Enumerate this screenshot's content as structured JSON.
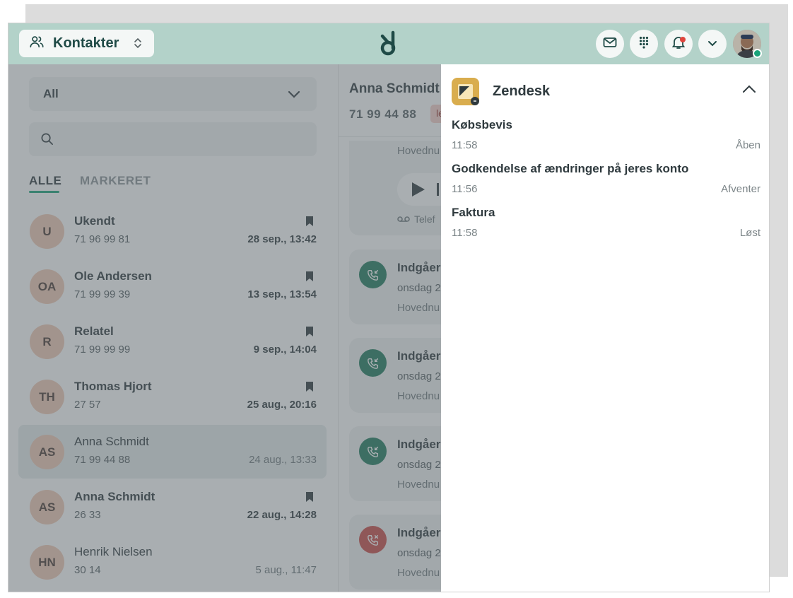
{
  "header": {
    "context_label": "Kontakter"
  },
  "filters": {
    "select_value": "All",
    "search_placeholder": ""
  },
  "tabs": {
    "all": "ALLE",
    "marked": "MARKERET"
  },
  "contacts": [
    {
      "initials": "U",
      "name": "Ukendt",
      "number": "71 96 99 81",
      "date": "28 sep., 13:42",
      "bookmarked": true
    },
    {
      "initials": "OA",
      "name": "Ole Andersen",
      "number": "71 99 99 39",
      "date": "13 sep., 13:54",
      "bookmarked": true
    },
    {
      "initials": "R",
      "name": "Relatel",
      "number": "71 99 99 99",
      "date": "9 sep., 14:04",
      "bookmarked": true
    },
    {
      "initials": "TH",
      "name": "Thomas Hjort",
      "number": "27 57",
      "date": "25 aug., 20:16",
      "bookmarked": true
    },
    {
      "initials": "AS",
      "name": "Anna Schmidt",
      "number": "71 99 44 88",
      "date": "24 aug., 13:33",
      "bookmarked": false,
      "selected": true
    },
    {
      "initials": "AS",
      "name": "Anna Schmidt",
      "number": "26 33",
      "date": "22 aug., 14:28",
      "bookmarked": true
    },
    {
      "initials": "HN",
      "name": "Henrik Nielsen",
      "number": "30 14",
      "date": "5 aug., 11:47",
      "bookmarked": false
    }
  ],
  "detail": {
    "name": "Anna Schmidt",
    "number": "71 99 44 88",
    "tag": "le",
    "voicemail_card": {
      "line": "Hovednu",
      "footer": "Telef"
    },
    "calls": [
      {
        "title": "Indgåer",
        "date": "onsdag 2",
        "line": "Hovednu",
        "status": "answered"
      },
      {
        "title": "Indgåer",
        "date": "onsdag 2",
        "line": "Hovednu",
        "status": "answered"
      },
      {
        "title": "Indgåer",
        "date": "onsdag 2",
        "line": "Hovednu",
        "status": "answered"
      },
      {
        "title": "Indgåer",
        "date": "onsdag 2",
        "line": "Hovednu",
        "status": "missed"
      }
    ]
  },
  "zendesk": {
    "title": "Zendesk",
    "tickets": [
      {
        "title": "Købsbevis",
        "time": "11:58",
        "status": "Åben"
      },
      {
        "title": "Godkendelse af ændringer på jeres konto",
        "time": "11:56",
        "status": "Afventer"
      },
      {
        "title": "Faktura",
        "time": "11:58",
        "status": "Løst"
      }
    ]
  },
  "colors": {
    "topbar": "#b3d2c9",
    "accent": "#1aa37a",
    "call_answered": "#1f7a5c",
    "call_missed": "#c94a45",
    "avatar": "#f1c9b4",
    "zendesk_logo": "#d9ad4e"
  },
  "icons": [
    "contacts-icon",
    "chevron-updown-icon",
    "app-logo-icon",
    "mail-icon",
    "dialpad-icon",
    "bell-icon",
    "chevron-down-icon",
    "search-icon",
    "bookmark-icon",
    "play-icon",
    "voicemail-icon",
    "incoming-call-icon",
    "missed-call-icon",
    "zendesk-logo-icon",
    "chevron-up-icon"
  ]
}
